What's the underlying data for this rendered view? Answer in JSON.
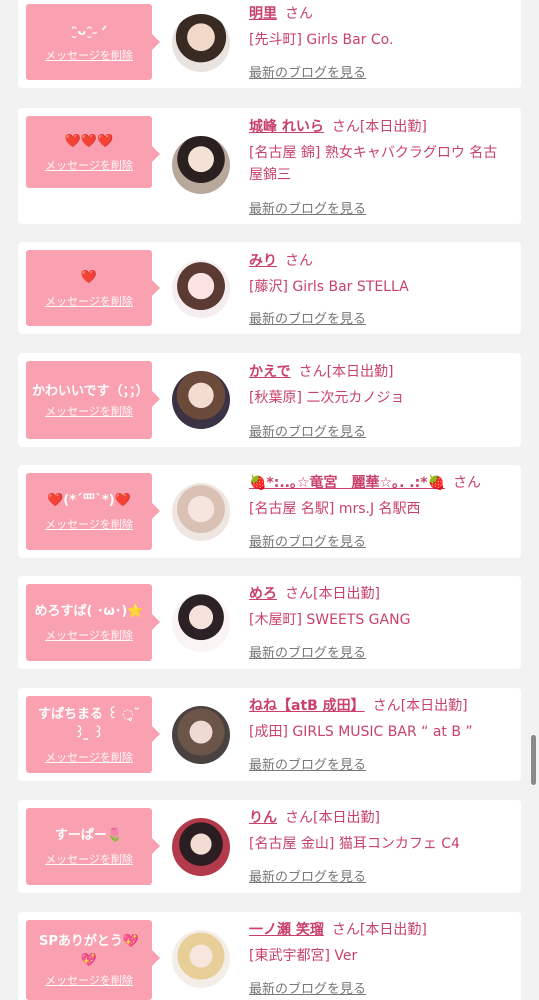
{
  "delete_label": "メッセージを削除",
  "blog_label": "最新のブログを見る",
  "san_label": "さん",
  "items": [
    {
      "message": "ᵔ̮ᴗᵔ̮˶ ᐟ",
      "name": "明里",
      "status": "",
      "shop": "[先斗町] Girls Bar Co."
    },
    {
      "message": "❤️❤️❤️",
      "name": "城峰 れいら",
      "status": "[本日出勤]",
      "shop": "[名古屋 錦] 熟女キャバクラグロウ 名古屋錦三"
    },
    {
      "message": "❤️",
      "name": "みり",
      "status": "",
      "shop": "[藤沢] Girls Bar STELLA"
    },
    {
      "message": "かわいいです（；；）",
      "name": "かえで",
      "status": "[本日出勤]",
      "shop": "[秋葉原] 二次元カノジョ"
    },
    {
      "message": "❤️(*´罒`*)❤️",
      "name": "🍓*:..｡☆竜宮　麗華☆｡. .:*🍓",
      "status": "",
      "shop": "[名古屋 名駅] mrs.J 名駅西"
    },
    {
      "message": "めろすぱ( ･ω･)⭐️",
      "name": "めろ",
      "status": "[本日出勤]",
      "shop": "[木屋町] SWEETS GANG"
    },
    {
      "message": "すぱちまる‪ ꒰ ◌̥˘ ꒱ ̫ ꒱",
      "name": "ねね【atB 成田】",
      "status": "[本日出勤]",
      "shop": "[成田] GIRLS MUSIC BAR “ at B ”"
    },
    {
      "message": "すーぱー🌷",
      "name": "りん",
      "status": "[本日出勤]",
      "shop": "[名古屋 金山] 猫耳コンカフェ C4"
    },
    {
      "message": "SPありがとう💖💖",
      "name": "一ノ瀬 笑瑠",
      "status": "[本日出勤]",
      "shop": "[東武宇都宮] Ver"
    }
  ]
}
